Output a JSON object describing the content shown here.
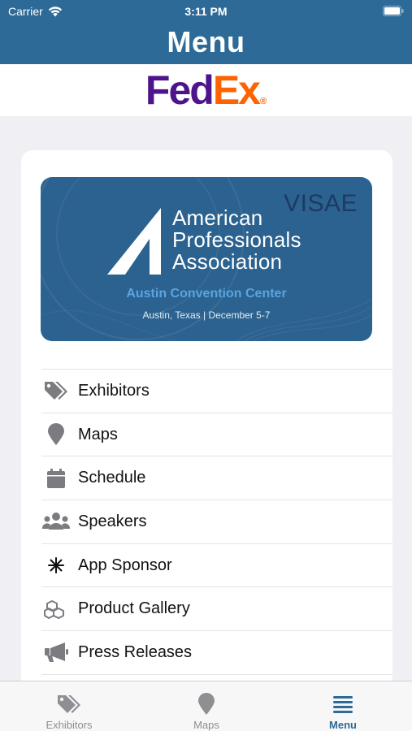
{
  "status_bar": {
    "carrier": "Carrier",
    "time": "3:11 PM"
  },
  "header": {
    "title": "Menu"
  },
  "sponsor": {
    "fed": "Fed",
    "ex": "Ex",
    "reg": "®"
  },
  "event": {
    "partner": "VISAE",
    "org_line1": "American",
    "org_line2": "Professionals",
    "org_line3": "Association",
    "venue": "Austin Convention Center",
    "location": "Austin, Texas  |  December 5-7"
  },
  "menu": {
    "items": [
      {
        "label": "Exhibitors",
        "icon": "tags-icon"
      },
      {
        "label": "Maps",
        "icon": "map-marker-icon"
      },
      {
        "label": "Schedule",
        "icon": "calendar-icon"
      },
      {
        "label": "Speakers",
        "icon": "users-icon"
      },
      {
        "label": "App Sponsor",
        "icon": "sparkle-icon"
      },
      {
        "label": "Product Gallery",
        "icon": "cubes-icon"
      },
      {
        "label": "Press Releases",
        "icon": "megaphone-icon"
      }
    ]
  },
  "tabs": [
    {
      "label": "Exhibitors",
      "icon": "tags-icon",
      "active": false
    },
    {
      "label": "Maps",
      "icon": "map-marker-icon",
      "active": false
    },
    {
      "label": "Menu",
      "icon": "hamburger-icon",
      "active": true
    }
  ],
  "colors": {
    "brand": "#2d6a97",
    "icon_gray": "#7b7b80",
    "fedex_purple": "#4d148c",
    "fedex_orange": "#ff6200"
  }
}
